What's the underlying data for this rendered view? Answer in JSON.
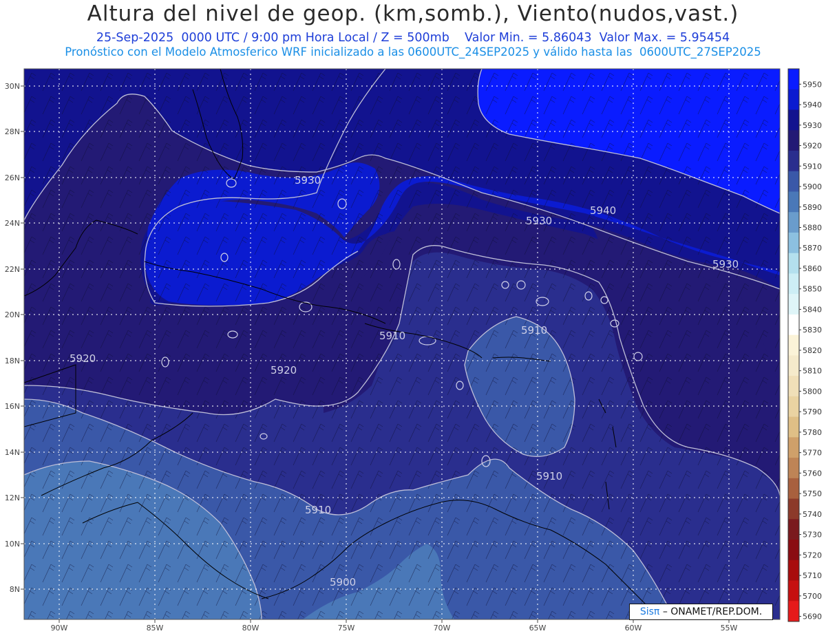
{
  "header": {
    "title": "Altura del nivel de geop. (km,somb.), Viento(nudos,vast.)",
    "line1": "25-Sep-2025  0000 UTC / 9:00 pm Hora Local / Z = 500mb    Valor Min. = 5.86043  Valor Max. = 5.95454",
    "line2": "Pronóstico con el Modelo Atmosferico WRF inicializado a las 0600UTC_24SEP2025 y válido hasta las  0600UTC_27SEP2025"
  },
  "map": {
    "lat_labels": [
      "30N",
      "28N",
      "26N",
      "24N",
      "22N",
      "20N",
      "18N",
      "16N",
      "14N",
      "12N",
      "10N",
      "8N"
    ],
    "lon_labels": [
      "90W",
      "85W",
      "80W",
      "75W",
      "70W",
      "65W",
      "60W",
      "55W"
    ],
    "contour_labels": [
      "5930",
      "5940",
      "5930",
      "5930",
      "5920",
      "5920",
      "5910",
      "5910",
      "5910",
      "5910",
      "5900"
    ],
    "colors": {
      "c5950": "#0a1cff",
      "c5940": "#0b1bd0",
      "c5930": "#12138f",
      "c5920": "#231a75",
      "c5910": "#2a2e8e",
      "c5900": "#3a58a8",
      "c5890": "#4a78b8",
      "coast": "#000000",
      "contour": "#bfbfd8"
    }
  },
  "colorbar": {
    "levels": [
      "5950",
      "5940",
      "5930",
      "5920",
      "5910",
      "5900",
      "5890",
      "5880",
      "5870",
      "5860",
      "5850",
      "5840",
      "5830",
      "5820",
      "5810",
      "5800",
      "5790",
      "5780",
      "5770",
      "5760",
      "5750",
      "5740",
      "5730",
      "5720",
      "5710",
      "5700",
      "5690"
    ],
    "colors": [
      "#0a1cff",
      "#0b1bd0",
      "#12138f",
      "#231a75",
      "#2a2e8e",
      "#3a58a8",
      "#4a78b8",
      "#6a9ccc",
      "#8cc0e0",
      "#b4e0ee",
      "#cdeef5",
      "#dff5f8",
      "#ffffff",
      "#fbf3d8",
      "#f5eacb",
      "#f0dfb8",
      "#ead3a2",
      "#dfbf86",
      "#cfa06a",
      "#be8456",
      "#a8603e",
      "#8c3a2a",
      "#7a1a1e",
      "#8a0d12",
      "#a80d0d",
      "#c61010",
      "#e61a1a"
    ]
  },
  "credit": {
    "brand": "Sisπ",
    "org": "– ONAMET/REP.DOM."
  }
}
